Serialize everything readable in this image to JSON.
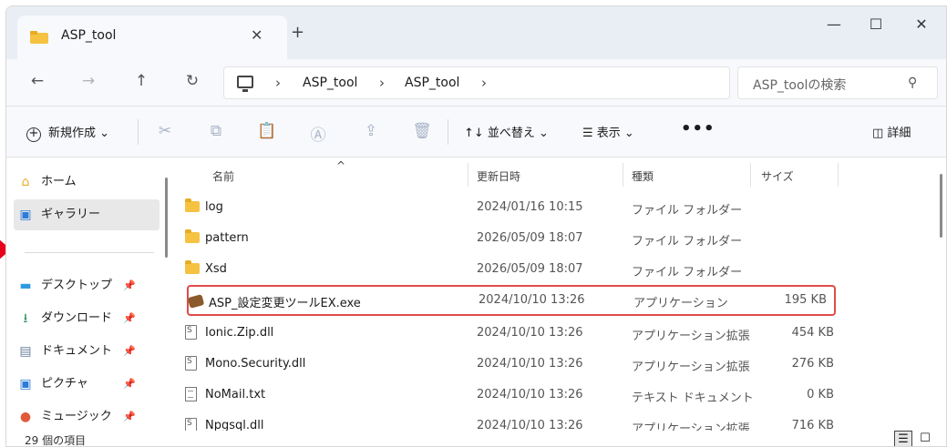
{
  "window": {
    "tab_title": "ASP_tool",
    "tab_close": "✕",
    "new_tab": "+",
    "minimize": "—",
    "maximize": "☐",
    "close": "✕"
  },
  "nav": {
    "back": "←",
    "forward": "→",
    "up": "↑",
    "refresh": "↻",
    "breadcrumbs": [
      "ASP_tool",
      "ASP_tool"
    ],
    "separator": "›",
    "search_placeholder": "ASP_toolの検索",
    "search_glyph": "⚲"
  },
  "toolbar": {
    "new_label": "新規作成 ⌄",
    "new_glyph": "+",
    "cut": "✂",
    "copy": "⧉",
    "paste": "📋",
    "rename": "Ⓐ",
    "share": "⇪",
    "delete": "🗑",
    "sort_label": "↑↓ 並べ替え ⌄",
    "view_label": "☰ 表示 ⌄",
    "more": "•••",
    "details_label": "◫ 詳細"
  },
  "sidebar": {
    "items": [
      {
        "label": "ホーム",
        "icon": "home-icon",
        "glyph": "⌂",
        "color": "#e8ac22"
      },
      {
        "label": "ギャラリー",
        "icon": "gallery-icon",
        "glyph": "▣",
        "color": "#2f7bd8"
      },
      {
        "label": "デスクトップ",
        "icon": "desktop-icon",
        "glyph": "▬",
        "color": "#2f9ae0"
      },
      {
        "label": "ダウンロード",
        "icon": "download-icon",
        "glyph": "⭳",
        "color": "#2d8f5a"
      },
      {
        "label": "ドキュメント",
        "icon": "documents-icon",
        "glyph": "▤",
        "color": "#6b7f99"
      },
      {
        "label": "ピクチャ",
        "icon": "pictures-icon",
        "glyph": "▣",
        "color": "#2f7bd8"
      },
      {
        "label": "ミュージック",
        "icon": "music-icon",
        "glyph": "●",
        "color": "#e05a3a"
      }
    ],
    "pin_glyph": "📌"
  },
  "columns": {
    "name": "名前",
    "date": "更新日時",
    "type": "種類",
    "size": "サイズ",
    "sort_glyph": "^"
  },
  "files": [
    {
      "name": "log",
      "date": "2024/01/16 10:15",
      "type": "ファイル フォルダー",
      "size": "",
      "kind": "folder"
    },
    {
      "name": "pattern",
      "date": "2026/05/09 18:07",
      "type": "ファイル フォルダー",
      "size": "",
      "kind": "folder"
    },
    {
      "name": "Xsd",
      "date": "2026/05/09 18:07",
      "type": "ファイル フォルダー",
      "size": "",
      "kind": "folder"
    },
    {
      "name": "ASP_設定変更ツールEX.exe",
      "date": "2024/10/10 13:26",
      "type": "アプリケーション",
      "size": "195 KB",
      "kind": "exe",
      "highlighted": true
    },
    {
      "name": "Ionic.Zip.dll",
      "date": "2024/10/10 13:26",
      "type": "アプリケーション拡張",
      "size": "454 KB",
      "kind": "dll"
    },
    {
      "name": "Mono.Security.dll",
      "date": "2024/10/10 13:26",
      "type": "アプリケーション拡張",
      "size": "276 KB",
      "kind": "dll"
    },
    {
      "name": "NoMail.txt",
      "date": "2024/10/10 13:26",
      "type": "テキスト ドキュメント",
      "size": "0 KB",
      "kind": "txt"
    },
    {
      "name": "Npgsql.dll",
      "date": "2024/10/10 13:26",
      "type": "アプリケーション拡張",
      "size": "716 KB",
      "kind": "dll"
    }
  ],
  "status": {
    "item_count": "29 個の項目",
    "details_view": "☰",
    "tiles_view": "☐"
  },
  "colors": {
    "highlight_border": "#e24a4a",
    "callout_arrow": "#e8001c"
  }
}
